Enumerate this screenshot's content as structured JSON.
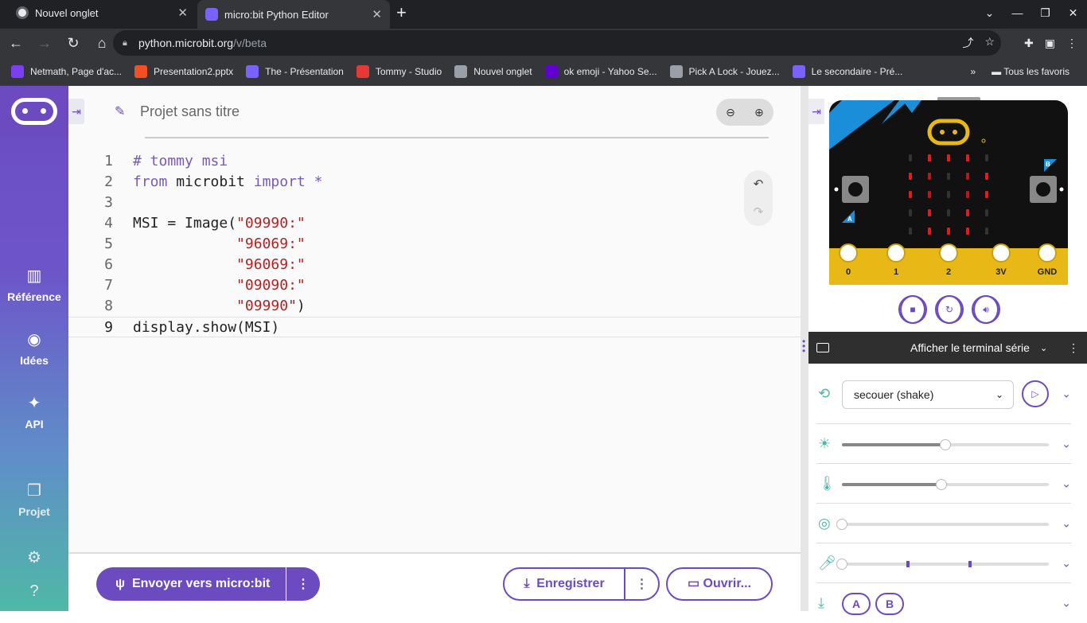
{
  "browser": {
    "tabs": [
      {
        "title": "Nouvel onglet",
        "icon": "chrome-icon",
        "active": false
      },
      {
        "title": "micro:bit Python Editor",
        "icon": "python-icon",
        "active": true
      }
    ],
    "url_host": "python.microbit.org",
    "url_path": "/v/beta",
    "bookmarks": [
      {
        "label": "Netmath, Page d'ac...",
        "color": "#7b3ff2"
      },
      {
        "label": "Presentation2.pptx",
        "color": "#f25022"
      },
      {
        "label": "The - Présentation",
        "color": "#7b61ff"
      },
      {
        "label": "Tommy - Studio",
        "color": "#e53935"
      },
      {
        "label": "Nouvel onglet",
        "color": "#9aa0a6"
      },
      {
        "label": "ok emoji - Yahoo Se...",
        "color": "#6001d2"
      },
      {
        "label": "Pick A Lock - Jouez...",
        "color": "#9aa0a6"
      },
      {
        "label": "Le secondaire - Pré...",
        "color": "#7b61ff"
      }
    ],
    "all_bookmarks": "Tous les favoris"
  },
  "nav": {
    "reference": "Référence",
    "ideas": "Idées",
    "api": "API",
    "project": "Projet"
  },
  "editor": {
    "project_title": "Projet sans titre",
    "active_line": 9,
    "lines": [
      {
        "n": "1",
        "parts": [
          {
            "t": "# tommy msi",
            "c": "cm"
          }
        ]
      },
      {
        "n": "2",
        "parts": [
          {
            "t": "from",
            "c": "kw"
          },
          {
            "t": " microbit ",
            "c": ""
          },
          {
            "t": "import",
            "c": "kw"
          },
          {
            "t": " *",
            "c": "kw"
          }
        ]
      },
      {
        "n": "3",
        "parts": []
      },
      {
        "n": "4",
        "parts": [
          {
            "t": "MSI = Image(",
            "c": ""
          },
          {
            "t": "\"09990:\"",
            "c": "st"
          }
        ]
      },
      {
        "n": "5",
        "parts": [
          {
            "t": "            ",
            "c": ""
          },
          {
            "t": "\"96069:\"",
            "c": "st"
          }
        ]
      },
      {
        "n": "6",
        "parts": [
          {
            "t": "            ",
            "c": ""
          },
          {
            "t": "\"96069:\"",
            "c": "st"
          }
        ]
      },
      {
        "n": "7",
        "parts": [
          {
            "t": "            ",
            "c": ""
          },
          {
            "t": "\"09090:\"",
            "c": "st"
          }
        ]
      },
      {
        "n": "8",
        "parts": [
          {
            "t": "            ",
            "c": ""
          },
          {
            "t": "\"09990\"",
            "c": "st"
          },
          {
            "t": ")",
            "c": ""
          }
        ]
      },
      {
        "n": "9",
        "parts": [
          {
            "t": "display.show(MSI)",
            "c": ""
          }
        ]
      }
    ]
  },
  "actions": {
    "send": "Envoyer vers micro:bit",
    "save": "Enregistrer",
    "open": "Ouvrir..."
  },
  "simulator": {
    "pins": [
      "0",
      "1",
      "2",
      "3V",
      "GND"
    ],
    "button_a": "A",
    "button_b": "B",
    "led_matrix": [
      "09990",
      "96069",
      "96069",
      "09090",
      "09990"
    ],
    "led_color": "#e01e1e",
    "serial_label": "Afficher le terminal série",
    "gesture": "secouer (shake)",
    "light_level": 0.5,
    "temperature_level": 0.48,
    "compass_level": 0.0,
    "sound_level": 0.0,
    "sound_thresholds": [
      0.31,
      0.61
    ],
    "accent": "#6c4bc1"
  }
}
